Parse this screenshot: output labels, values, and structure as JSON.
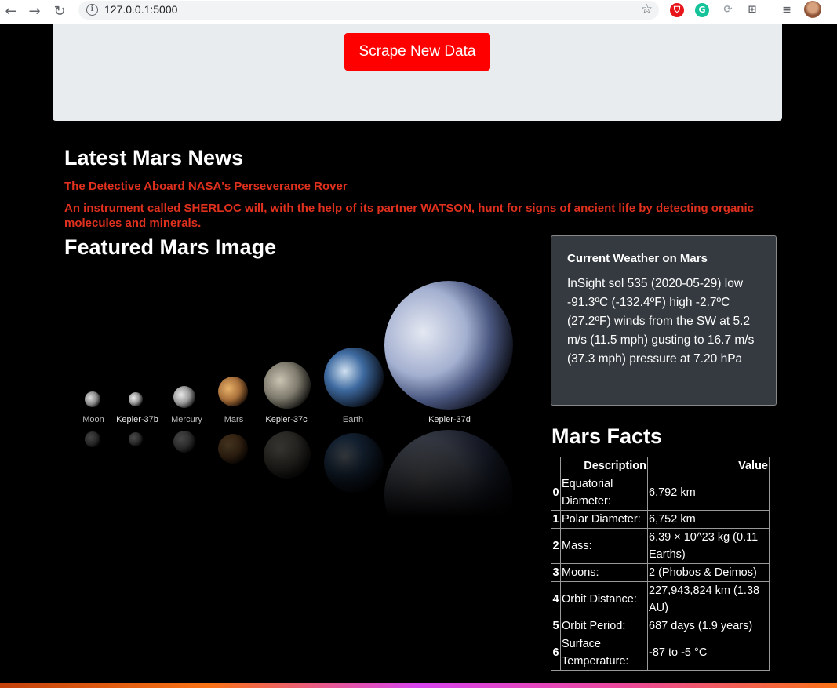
{
  "browser": {
    "url": "127.0.0.1:5000",
    "back_icon": "←",
    "forward_icon": "→",
    "reload_icon": "↻",
    "star_icon": "☆"
  },
  "jumbotron": {
    "button_label": "Scrape New Data",
    "button_color": "#ff0000"
  },
  "news": {
    "heading": "Latest Mars News",
    "title": "The Detective Aboard NASA's Perseverance Rover",
    "teaser": "An instrument called SHERLOC will, with the help of its partner WATSON, hunt for signs of ancient life by detecting organic molecules and minerals."
  },
  "featured_image": {
    "heading": "Featured Mars Image",
    "labels": [
      "Moon",
      "Kepler-37b",
      "Mercury",
      "Mars",
      "Kepler-37c",
      "Earth",
      "Kepler-37d"
    ]
  },
  "weather": {
    "title": "Current Weather on Mars",
    "text": "InSight sol 535 (2020-05-29) low -91.3ºC (-132.4ºF) high -2.7ºC (27.2ºF) winds from the SW at 5.2 m/s (11.5 mph) gusting to 16.7 m/s (37.3 mph) pressure at 7.20 hPa"
  },
  "facts": {
    "heading": "Mars Facts",
    "columns": [
      "",
      "Description",
      "Value"
    ],
    "rows": [
      {
        "index": "0",
        "description": "Equatorial Diameter:",
        "value": "6,792 km"
      },
      {
        "index": "1",
        "description": "Polar Diameter:",
        "value": "6,752 km"
      },
      {
        "index": "2",
        "description": "Mass:",
        "value": "6.39 × 10^23 kg (0.11 Earths)"
      },
      {
        "index": "3",
        "description": "Moons:",
        "value": "2 (Phobos & Deimos)"
      },
      {
        "index": "4",
        "description": "Orbit Distance:",
        "value": "227,943,824 km (1.38 AU)"
      },
      {
        "index": "5",
        "description": "Orbit Period:",
        "value": "687 days (1.9 years)"
      },
      {
        "index": "6",
        "description": "Surface Temperature:",
        "value": "-87 to -5 °C"
      }
    ]
  }
}
